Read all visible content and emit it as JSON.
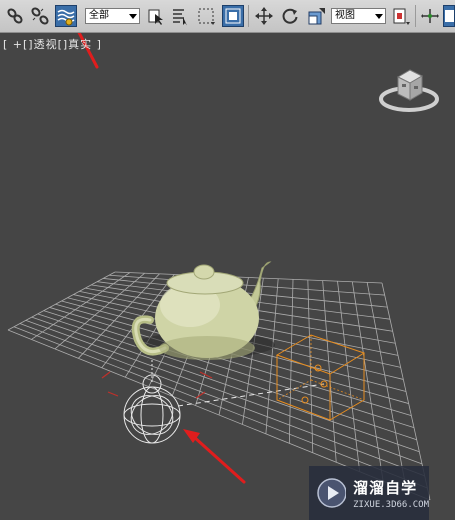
{
  "toolbar": {
    "selection_filter": "全部",
    "ref_coord_system": "视图"
  },
  "viewport": {
    "label": "[ +[]透视[]真实 ]"
  },
  "watermark": {
    "title": "溜溜自学",
    "subtitle": "ZIXUE.3D66.COM"
  },
  "colors": {
    "viewport_bg": "#454545",
    "grid": "#b8b8b8",
    "teapot": "#cfd4a6",
    "camera_target": "#e88d1e",
    "annotation_arrow": "#e01d1d",
    "active_button": "#3a6ea8"
  },
  "icons": [
    "link-icon",
    "unlink-icon",
    "bind-spacewarp-icon",
    "select-object-icon",
    "select-by-name-icon",
    "rectangle-selection-icon",
    "window-crossing-icon",
    "move-icon",
    "rotate-icon",
    "scale-icon",
    "use-pivot-icon",
    "select-manipulate-icon",
    "viewcube-icon",
    "play-icon"
  ]
}
